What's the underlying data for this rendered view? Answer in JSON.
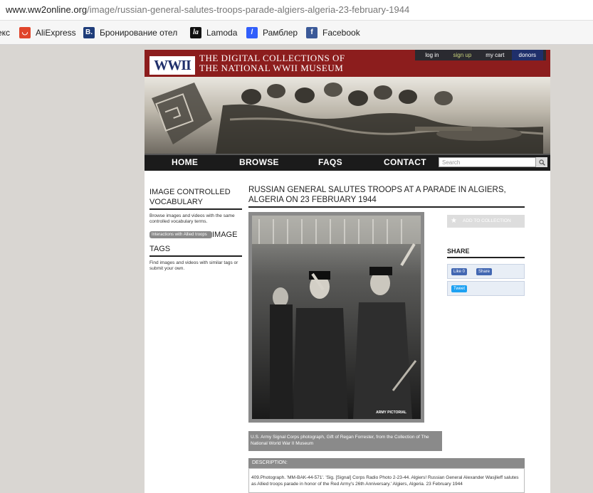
{
  "browser": {
    "url_domain": "www.ww2online.org",
    "url_path": "/image/russian-general-salutes-troops-parade-algiers-algeria-23-february-1944",
    "bookmarks": [
      {
        "label": "екс",
        "icon": "none"
      },
      {
        "label": "AliExpress",
        "icon": "aliexpress-icon"
      },
      {
        "label": "Бронирование отел",
        "icon": "booking-icon"
      },
      {
        "label": "Lamoda",
        "icon": "lamoda-icon"
      },
      {
        "label": "Рамблер",
        "icon": "rambler-icon"
      },
      {
        "label": "Facebook",
        "icon": "facebook-icon"
      }
    ]
  },
  "site": {
    "logo": "WWII",
    "title_line1": "THE DIGITAL COLLECTIONS OF",
    "title_line2": "THE NATIONAL WWII MUSEUM",
    "user_links": {
      "login": "log in",
      "signup": "sign up",
      "cart": "my cart",
      "donors": "donors"
    },
    "nav": [
      "HOME",
      "BROWSE",
      "FAQS",
      "CONTACT"
    ],
    "search_placeholder": "Search",
    "colors": {
      "brand_red": "#8c1d1d",
      "navy": "#1f2f6b"
    }
  },
  "sidebar": {
    "vocab_heading": "IMAGE CONTROLLED VOCABULARY",
    "vocab_text": "Browse images and videos with the same controlled vocabulary terms.",
    "vocab_pill": "Interactions with Allied troops",
    "tags_heading_a": "IMAGE",
    "tags_heading_b": "TAGS",
    "tags_text": "Find images and videos with similar tags or submit your own."
  },
  "main": {
    "title": "RUSSIAN GENERAL SALUTES TROOPS AT A PARADE IN ALGIERS, ALGERIA ON 23 FEBRUARY 1944",
    "photo_watermark": "ARMY PICTORIAL",
    "caption": "U.S. Army Signal Corps photograph, Gift of Regan Forrester, from the Collection of The National World War II Museum",
    "description_label": "DESCRIPTION:",
    "description": "409.Photograph. 'MM-BAK-44-571'. 'Sig. [Signal] Corps Radio Photo 2-23-44. Algiers! Russian General Alexander Wasjlieff salutes as Allied troops parade in honor of the Red Army's 26th Anniversary.' Algiers, Algeria. 23 February 1944"
  },
  "right": {
    "add_label": "ADD TO COLLECTION",
    "share_heading": "SHARE",
    "like_label": "Like 0",
    "share_label": "Share",
    "tweet_label": "Tweet"
  }
}
